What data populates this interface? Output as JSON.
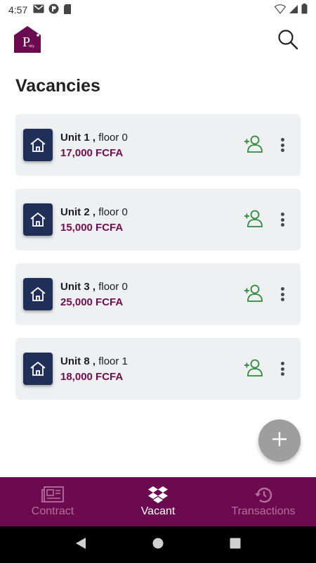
{
  "status_bar": {
    "time": "4:57",
    "left_icons": [
      "gmail-icon",
      "pocket-icon",
      "sd-card-icon"
    ],
    "right_icons": [
      "wifi-icon",
      "signal-icon",
      "battery-icon"
    ]
  },
  "header": {
    "logo_icon": "p-house-logo-icon",
    "search_icon": "search-icon"
  },
  "page": {
    "title": "Vacancies"
  },
  "vacancies": [
    {
      "unit": "Unit 1 ,",
      "floor": "floor 0",
      "price": "17,000 FCFA"
    },
    {
      "unit": "Unit 2 ,",
      "floor": "floor 0",
      "price": "15,000 FCFA"
    },
    {
      "unit": "Unit 3 ,",
      "floor": "floor 0",
      "price": "25,000 FCFA"
    },
    {
      "unit": "Unit 8 ,",
      "floor": "floor 1",
      "price": "18,000 FCFA"
    }
  ],
  "fab": {
    "icon": "plus-icon"
  },
  "bottom_nav": {
    "items": [
      {
        "label": "Contract",
        "icon": "newspaper-icon",
        "active": false
      },
      {
        "label": "Vacant",
        "icon": "dropbox-icon",
        "active": true
      },
      {
        "label": "Transactions",
        "icon": "history-icon",
        "active": false
      }
    ]
  },
  "colors": {
    "brand": "#6b0a4e",
    "price": "#6d0f4e",
    "unit_icon_bg": "#1f2f57",
    "assign_icon": "#2e8b3a",
    "card_bg": "#eff0f2",
    "fab": "#9e9e9e"
  }
}
